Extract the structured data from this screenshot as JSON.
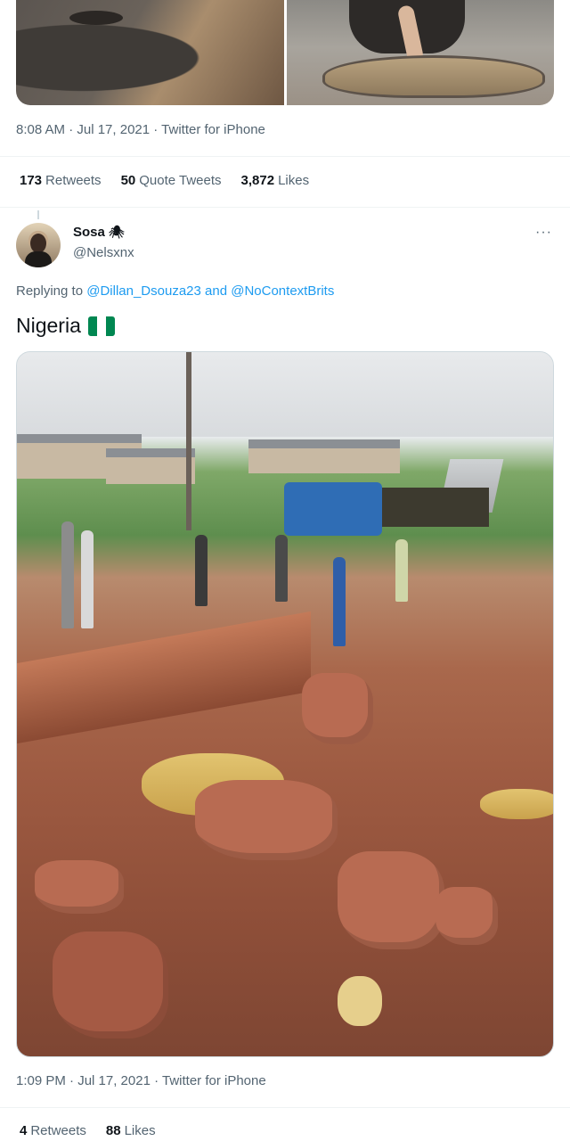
{
  "previous_tweet": {
    "timestamp": "8:08 AM · Jul 17, 2021 · Twitter for iPhone",
    "stats": [
      {
        "count": "173",
        "label": "Retweets"
      },
      {
        "count": "50",
        "label": "Quote Tweets"
      },
      {
        "count": "3,872",
        "label": "Likes"
      }
    ]
  },
  "reply_tweet": {
    "display_name": "Sosa",
    "name_emoji": "🕷",
    "handle": "@Nelsxnx",
    "more_label": "···",
    "replying_prefix": "Replying to",
    "replying_user_1": "@Dillan_Dsouza23",
    "replying_and": "and",
    "replying_user_2": "@NoContextBrits",
    "text": "Nigeria",
    "flag_colors": [
      "#008751",
      "#ffffff",
      "#008751"
    ],
    "timestamp": "1:09 PM · Jul 17, 2021 · Twitter for iPhone",
    "stats": [
      {
        "count": "4",
        "label": "Retweets"
      },
      {
        "count": "88",
        "label": "Likes"
      }
    ]
  },
  "colors": {
    "link": "#1d9bf0",
    "secondary_text": "#536471",
    "primary_text": "#0f1419",
    "divider": "#eff3f4"
  }
}
